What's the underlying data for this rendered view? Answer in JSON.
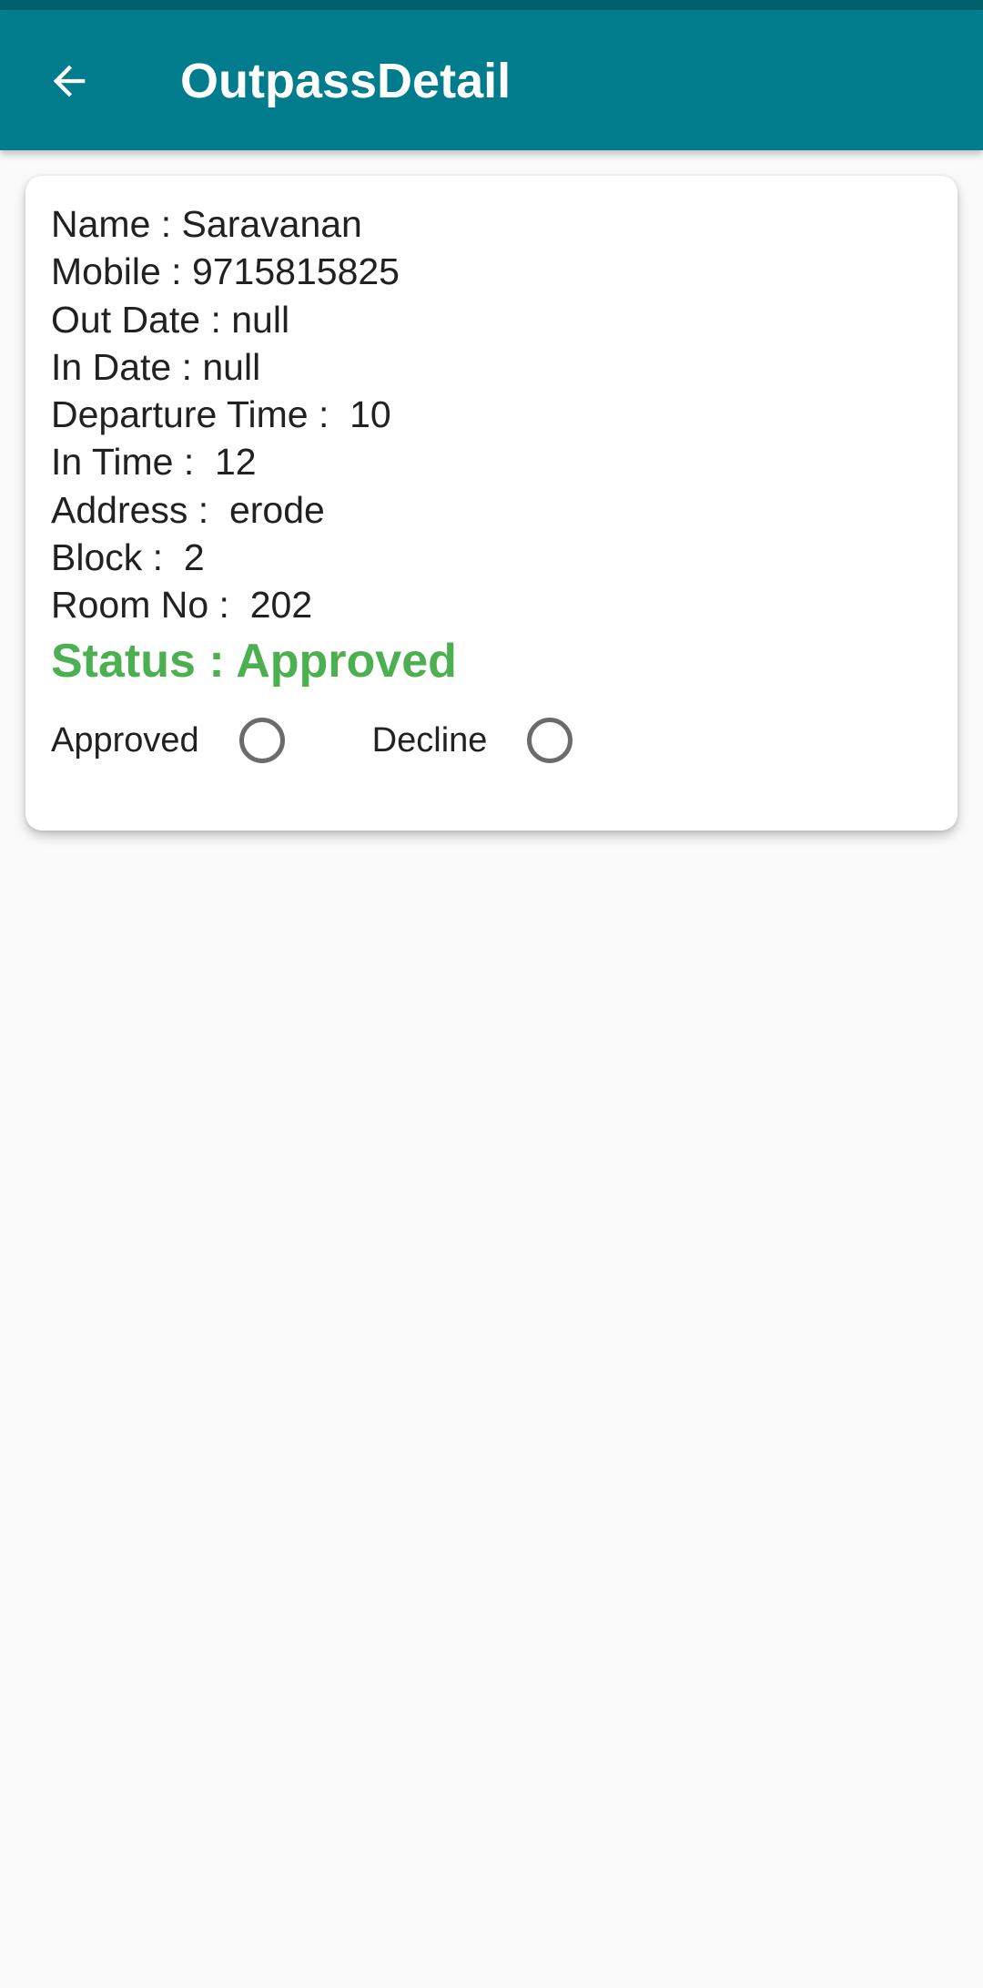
{
  "app_bar": {
    "title": "OutpassDetail",
    "back_icon": "arrow-left-icon"
  },
  "details": [
    {
      "text": "Name : Saravanan"
    },
    {
      "text": "Mobile : 9715815825"
    },
    {
      "text": "Out Date : null"
    },
    {
      "text": "In Date : null"
    },
    {
      "text": "Departure Time :  10"
    },
    {
      "text": "In Time :  12"
    },
    {
      "text": "Address :  erode"
    },
    {
      "text": "Block :  2"
    },
    {
      "text": "Room No :  202"
    }
  ],
  "status": {
    "text": "Status : Approved",
    "color": "#4caf50"
  },
  "options": [
    {
      "label": "Approved",
      "selected": false
    },
    {
      "label": "Decline",
      "selected": false
    }
  ],
  "colors": {
    "app_bar": "#007c8c",
    "status_bar": "#005f6b",
    "background": "#fafafa"
  }
}
